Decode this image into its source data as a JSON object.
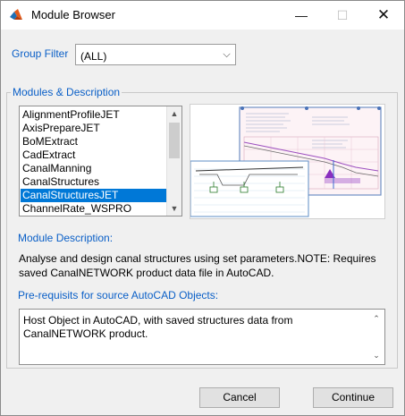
{
  "window": {
    "title": "Module Browser",
    "app_icon": "matlab-logo"
  },
  "titlebar": {
    "minimize": "—",
    "maximize": "☐",
    "close": "✕"
  },
  "group_filter": {
    "label": "Group Filter",
    "value": "(ALL)"
  },
  "modules_group": {
    "legend": "Modules & Description",
    "items": [
      "AlignmentProfileJET",
      "AxisPrepareJET",
      "BoMExtract",
      "CadExtract",
      "CanalManning",
      "CanalStructures",
      "CanalStructuresJET",
      "ChannelRate_WSPRO"
    ],
    "selected_index": 6
  },
  "module_description": {
    "label": "Module Description:",
    "text": "Analyse and design canal structures using set parameters.NOTE: Requires saved CanalNETWORK product data file in AutoCAD."
  },
  "prerequisites": {
    "label": "Pre-requisits for source AutoCAD Objects:",
    "text": "Host Object in AutoCAD, with saved structures data from CanalNETWORK product."
  },
  "buttons": {
    "cancel": "Cancel",
    "continue": "Continue"
  },
  "colors": {
    "accent_label": "#0a5fc7",
    "selection": "#0078d7"
  }
}
